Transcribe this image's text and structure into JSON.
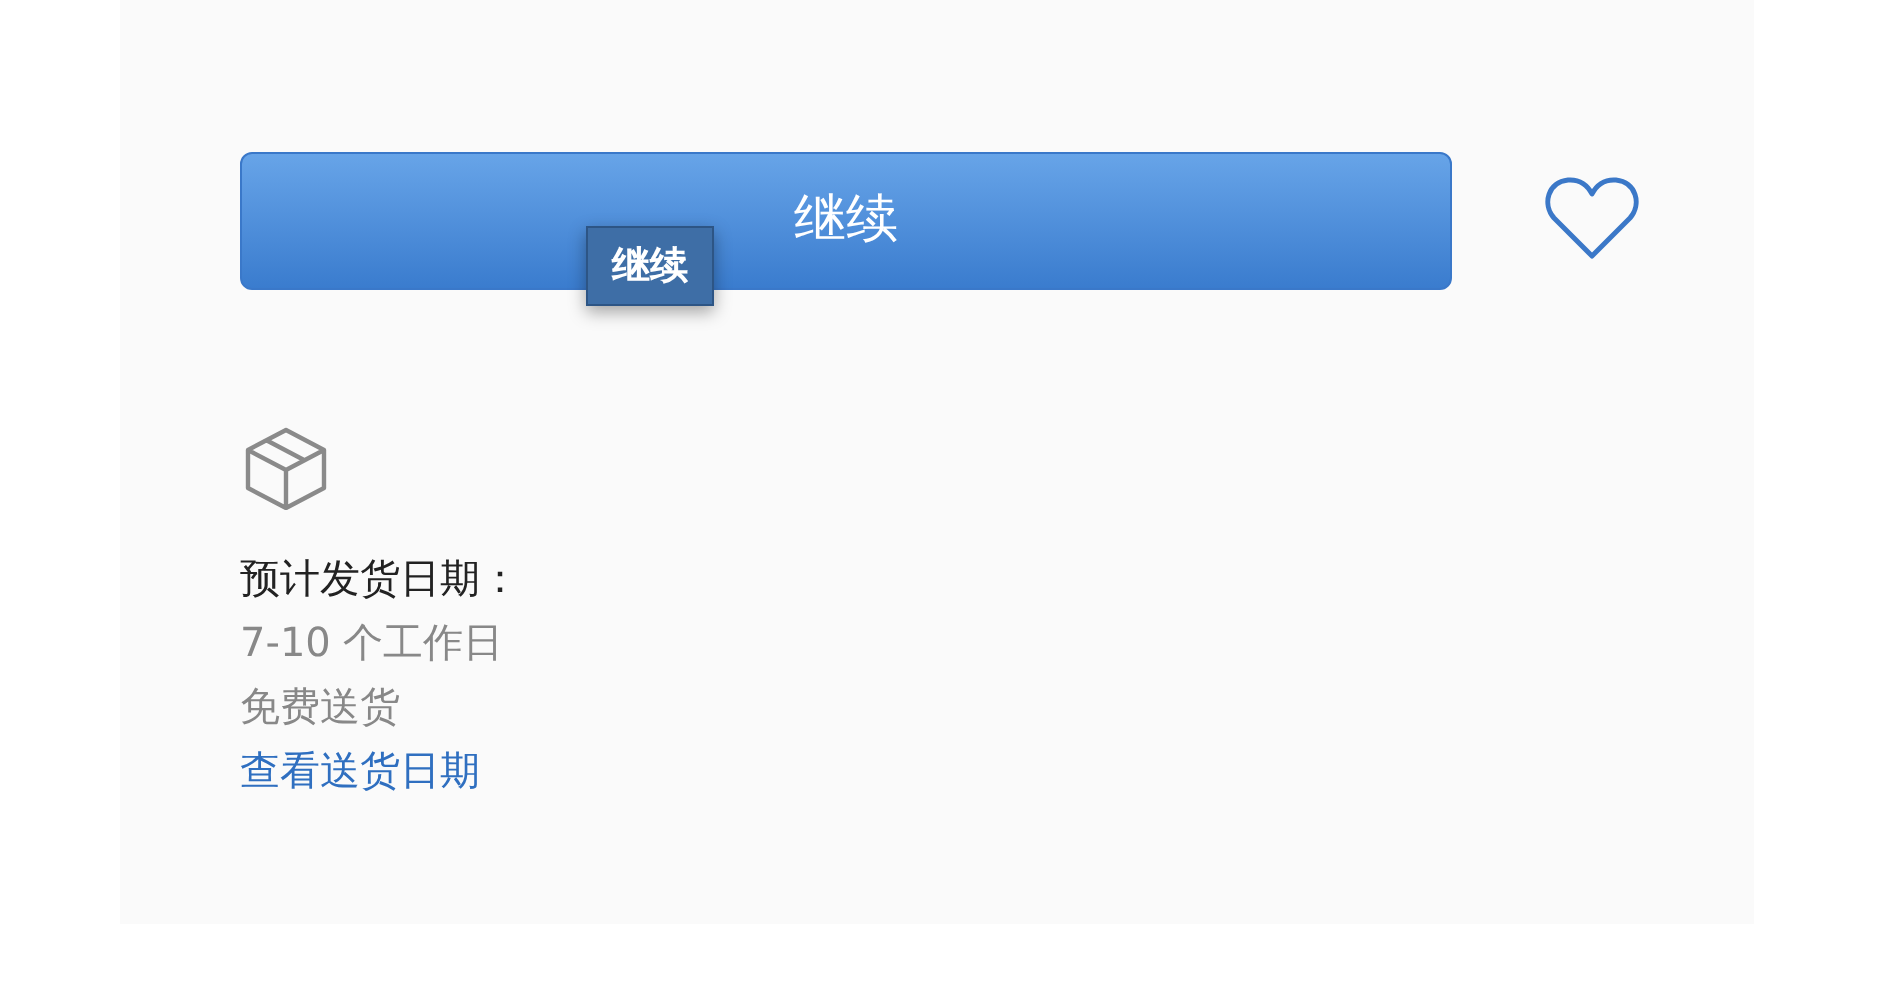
{
  "continue_button": {
    "label": "继续"
  },
  "tooltip": {
    "text": "继续"
  },
  "favorite": {
    "checked": false
  },
  "delivery": {
    "heading": "预计发货日期：",
    "lead_time": "7-10 个工作日",
    "shipping": "免费送货",
    "link": "查看送货日期"
  }
}
